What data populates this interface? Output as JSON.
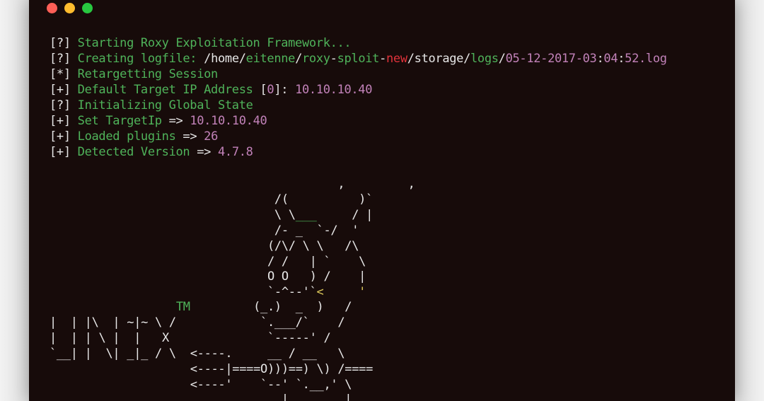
{
  "window": {
    "buttons": [
      "close",
      "minimize",
      "zoom"
    ],
    "colors": {
      "background": "#170b0a",
      "green": "#4fb35a",
      "magenta": "#c282b9",
      "red": "#e0323a",
      "yellow": "#dcc85a"
    }
  },
  "log": [
    {
      "prefix": "[?]",
      "message": "Starting Roxy Exploitation Framework..."
    },
    {
      "prefix": "[?]",
      "message": "Creating logfile:",
      "path": {
        "p1": "/home/",
        "p2": "eitenne",
        "p3": "/",
        "p4": "roxy",
        "p5": "-",
        "p6": "sploit",
        "p7": "-",
        "p8": "new",
        "p9": "/storage/",
        "p10": "logs",
        "p11": "/",
        "p12": "05-12-2017-03",
        "p13": ":",
        "p14": "04",
        "p15": ":",
        "p16": "52.log"
      }
    },
    {
      "prefix": "[*]",
      "message": "Retargetting Session"
    },
    {
      "prefix": "[+]",
      "message": "Default Target IP Address",
      "open": "[",
      "index": "0",
      "close": "]:",
      "value": "10.10.10.40"
    },
    {
      "prefix": "[?]",
      "message": "Initializing Global State"
    },
    {
      "prefix": "[+]",
      "message": "Set TargetIp",
      "arrow": "=>",
      "value": "10.10.10.40"
    },
    {
      "prefix": "[+]",
      "message": "Loaded plugins",
      "arrow": "=>",
      "value": "26"
    },
    {
      "prefix": "[+]",
      "message": "Detected Version",
      "arrow": "=>",
      "value": "4.7.8"
    }
  ],
  "banner": {
    "rows": [
      {
        "a": "                                         ,         ,"
      },
      {
        "a": "                                /(          )`"
      },
      {
        "a": "                                \\ \\",
        "b": "___",
        "c": "     / |"
      },
      {
        "a": "                                /- _  `-/  '"
      },
      {
        "a": "                               (/\\/ \\ \\   /\\"
      },
      {
        "a": "                               / /   | `    \\"
      },
      {
        "a": "                               O O   ) /    |"
      },
      {
        "a": "                               `-^--'`",
        "b": "<",
        "c": "     '"
      },
      {
        "a": "                  ",
        "b": "TM",
        "c": "         (_.)  _  )   /"
      },
      {
        "a": "|  | |\\  | ~|~ \\ /            `.___/`    /"
      },
      {
        "a": "|  | | \\ |  |   X              `-----' /"
      },
      {
        "a": "`__| |  \\| _|_ / \\  <----.     __ / __   \\"
      },
      {
        "a": "                    <----|====O)))==) \\) /===="
      },
      {
        "a": "                    <----'    `--' `.__,' \\"
      },
      {
        "a": "                                 |        |"
      }
    ]
  }
}
